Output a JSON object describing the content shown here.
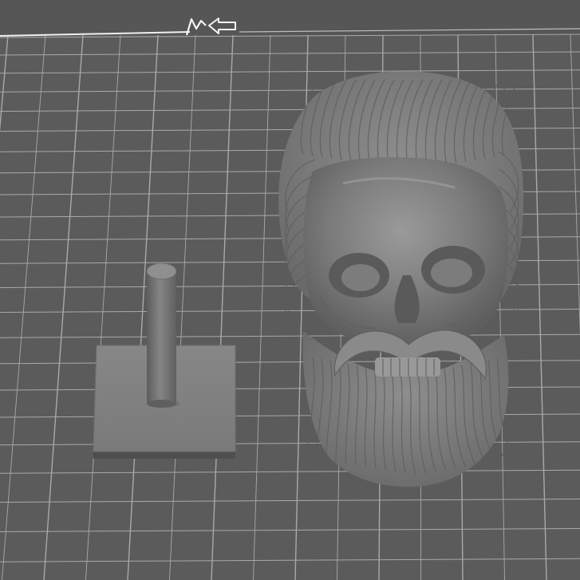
{
  "viewport": {
    "background_color": "#5b5b5b",
    "grid_color": "#a9a9a9",
    "bed_edge_color": "#f2f2f2",
    "model_color": "#7d7d7d",
    "icons": [
      "bed-logo-icon",
      "arrow-left-outline-icon"
    ]
  },
  "objects": [
    {
      "name": "support-stand",
      "kind": "peg-on-square-base"
    },
    {
      "name": "bearded-skull-bust",
      "kind": "sculpted-model"
    }
  ]
}
